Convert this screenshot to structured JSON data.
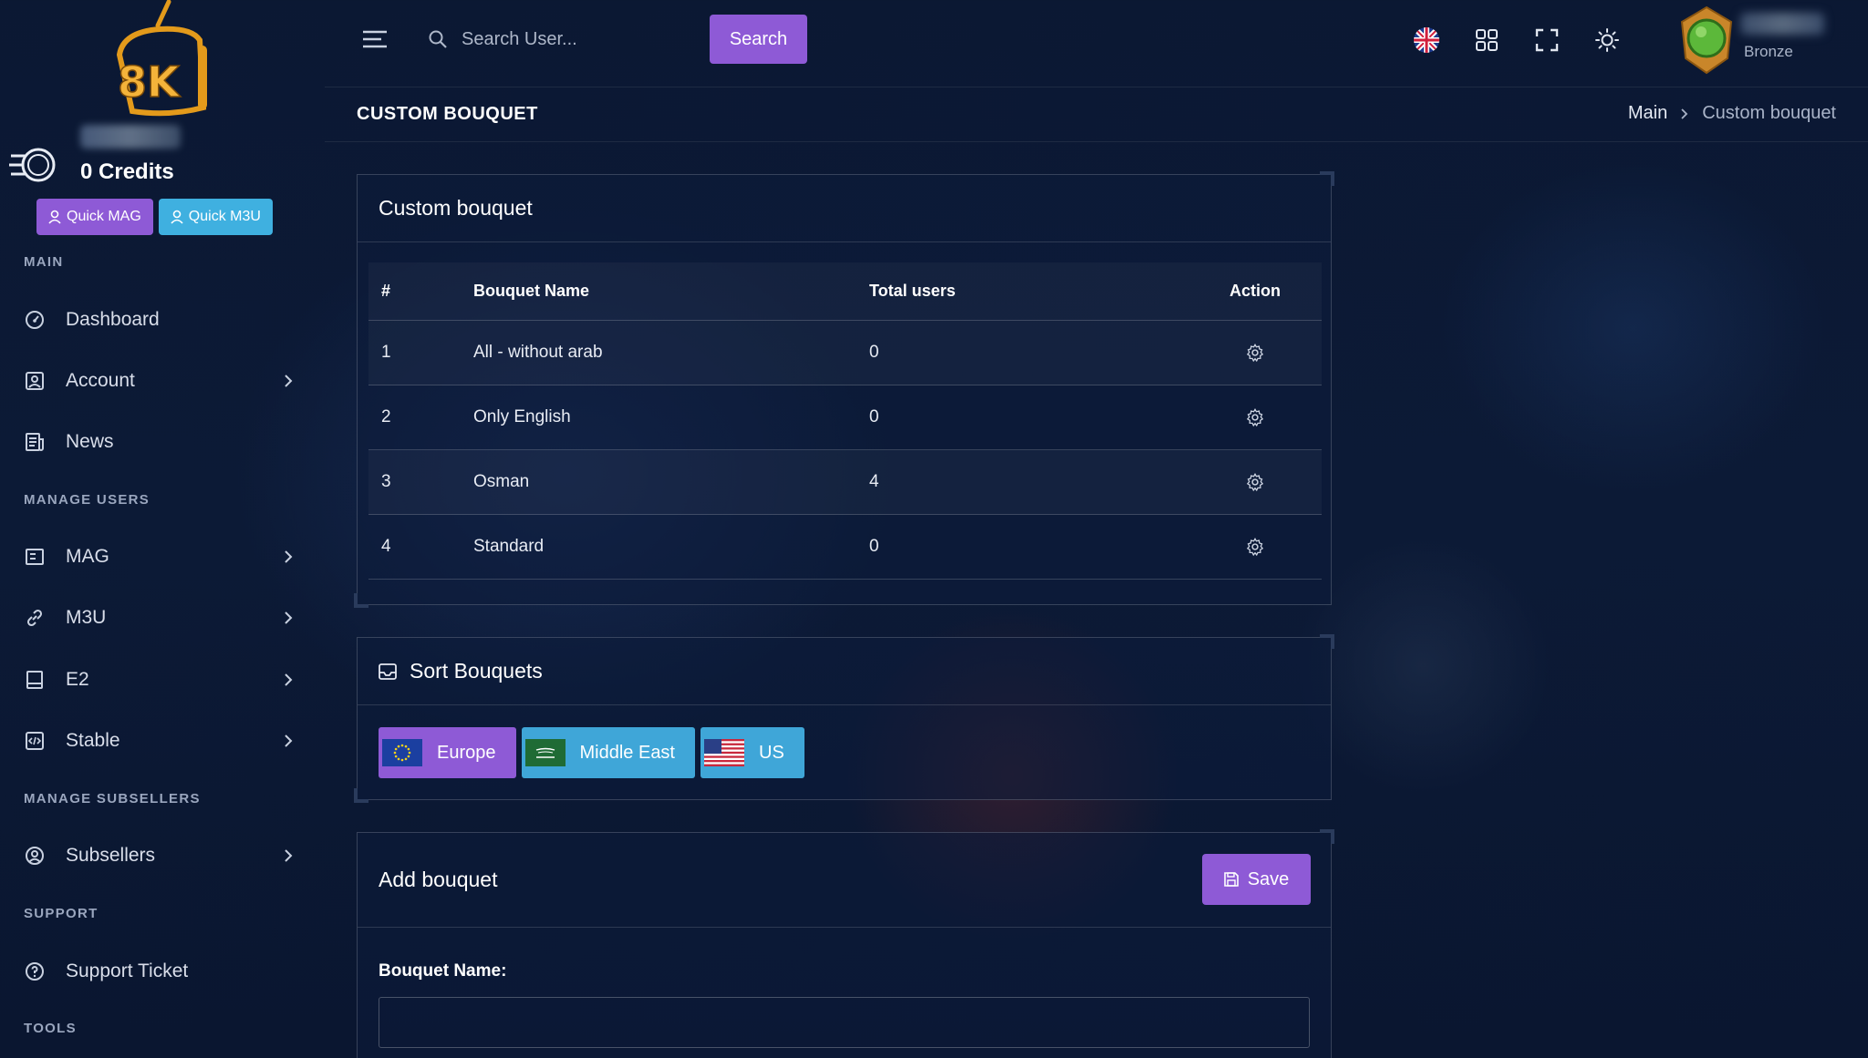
{
  "brand": {
    "logo_text": "8K"
  },
  "user": {
    "credits_label": "0 Credits",
    "rank": "Bronze"
  },
  "quick": {
    "mag_label": "Quick MAG",
    "m3u_label": "Quick M3U"
  },
  "sidebar": {
    "sections": {
      "main": "MAIN",
      "manage_users": "MANAGE USERS",
      "manage_subsellers": "MANAGE SUBSELLERS",
      "support": "SUPPORT",
      "tools": "TOOLS"
    },
    "items": [
      {
        "label": "Dashboard",
        "icon": "dashboard-icon"
      },
      {
        "label": "Account",
        "icon": "account-icon"
      },
      {
        "label": "News",
        "icon": "news-icon"
      },
      {
        "label": "MAG",
        "icon": "mag-icon"
      },
      {
        "label": "M3U",
        "icon": "link-icon"
      },
      {
        "label": "E2",
        "icon": "e2-icon"
      },
      {
        "label": "Stable",
        "icon": "code-icon"
      },
      {
        "label": "Subsellers",
        "icon": "user-circle-icon"
      },
      {
        "label": "Support Ticket",
        "icon": "help-icon"
      }
    ]
  },
  "topbar": {
    "search_placeholder": "Search User...",
    "search_label": "Search"
  },
  "page": {
    "title": "CUSTOM BOUQUET",
    "breadcrumb_main": "Main",
    "breadcrumb_current": "Custom bouquet"
  },
  "bouquet_card": {
    "title": "Custom bouquet",
    "columns": [
      "#",
      "Bouquet Name",
      "Total users",
      "Action"
    ],
    "rows": [
      {
        "num": "1",
        "name": "All - without arab",
        "users": "0"
      },
      {
        "num": "2",
        "name": "Only English",
        "users": "0"
      },
      {
        "num": "3",
        "name": "Osman",
        "users": "4"
      },
      {
        "num": "4",
        "name": "Standard",
        "users": "0"
      }
    ]
  },
  "sort_card": {
    "title": "Sort Bouquets",
    "tags": [
      "Europe",
      "Middle East",
      "US"
    ]
  },
  "add_card": {
    "title": "Add bouquet",
    "save_label": "Save",
    "field_label": "Bouquet Name:",
    "field_value": ""
  },
  "colors": {
    "accent": "#8e5ad6",
    "info": "#3fa6d8",
    "background": "#0b1833"
  }
}
